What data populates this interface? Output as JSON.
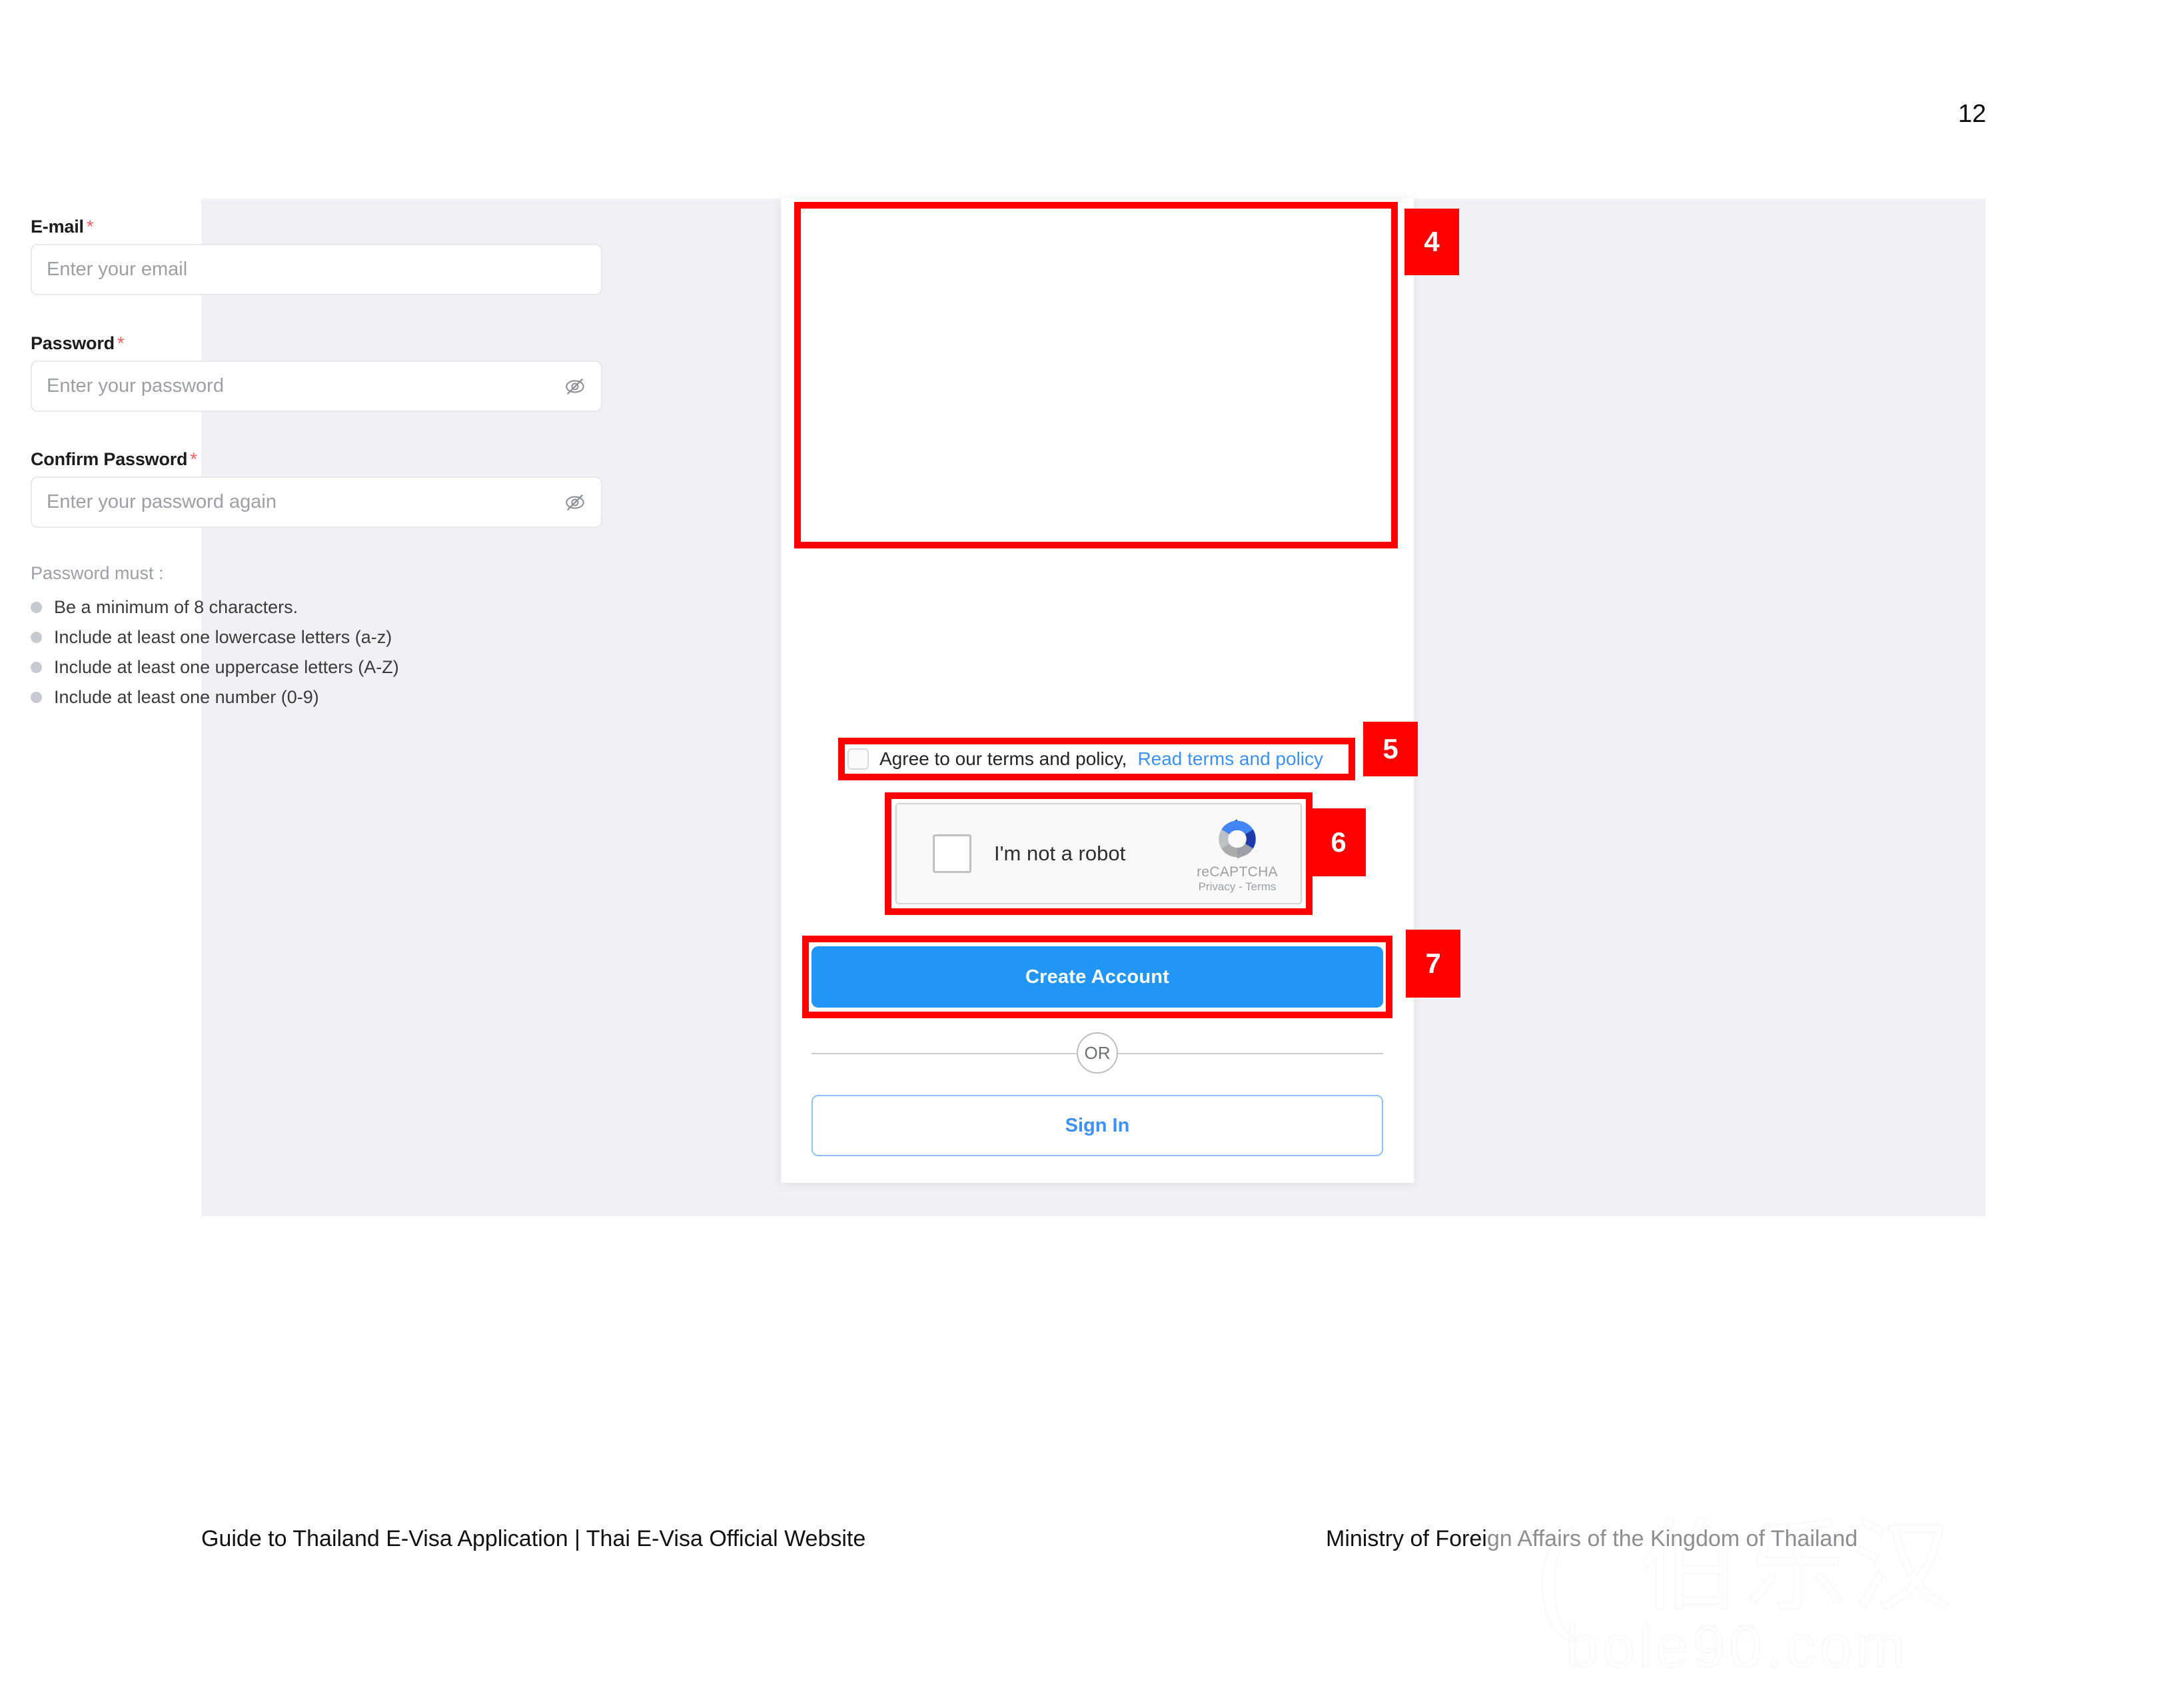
{
  "document": {
    "page_number": "12",
    "footer_left": "Guide to Thailand E-Visa Application | Thai E-Visa Official Website",
    "footer_right_bold": "Ministry of Forei",
    "footer_right_faded": "gn Affairs of the Kingdom of Thailand",
    "watermark_domain": "bole90.com",
    "watermark_cjk": "伯乐汉",
    "watermark_mark": "("
  },
  "colors": {
    "accent_blue": "#2196f7",
    "link_blue": "#3c91f5",
    "annotation_red": "#ff0000",
    "page_backdrop": "#eff1f5",
    "card_background": "#ffffff",
    "muted_text": "#9b9fa6",
    "required_star": "#fb5e5e"
  },
  "signup_form": {
    "fields": [
      {
        "id": "email",
        "label": "E-mail",
        "required_marker": "*",
        "placeholder": "Enter your email",
        "value": "",
        "has_reveal_toggle": false
      },
      {
        "id": "password",
        "label": "Password",
        "required_marker": "*",
        "placeholder": "Enter your password",
        "value": "",
        "has_reveal_toggle": true,
        "reveal_icon": "eye-slash-icon"
      },
      {
        "id": "confirm_password",
        "label": "Confirm Password",
        "required_marker": "*",
        "placeholder": "Enter your password again",
        "value": "",
        "has_reveal_toggle": true,
        "reveal_icon": "eye-slash-icon"
      }
    ],
    "password_rules": {
      "title": "Password must :",
      "items": [
        "Be a minimum of 8 characters.",
        "Include at least one lowercase letters (a-z)",
        "Include at least one uppercase letters (A-Z)",
        "Include at least one number (0-9)"
      ]
    },
    "terms": {
      "checked": false,
      "text": "Agree to our terms and policy,",
      "link_text": "Read terms and policy"
    },
    "recaptcha": {
      "checked": false,
      "label": "I'm not a robot",
      "brand": "reCAPTCHA",
      "legal": "Privacy - Terms",
      "logo_icon": "recaptcha-logo-icon"
    },
    "primary_button": "Create Account",
    "divider_label": "OR",
    "secondary_button": "Sign In"
  },
  "annotations": {
    "markers": [
      {
        "number": "4",
        "targets": "email-password-confirm-fields"
      },
      {
        "number": "5",
        "targets": "agree-terms-checkbox"
      },
      {
        "number": "6",
        "targets": "recaptcha-widget"
      },
      {
        "number": "7",
        "targets": "create-account-button"
      }
    ]
  }
}
